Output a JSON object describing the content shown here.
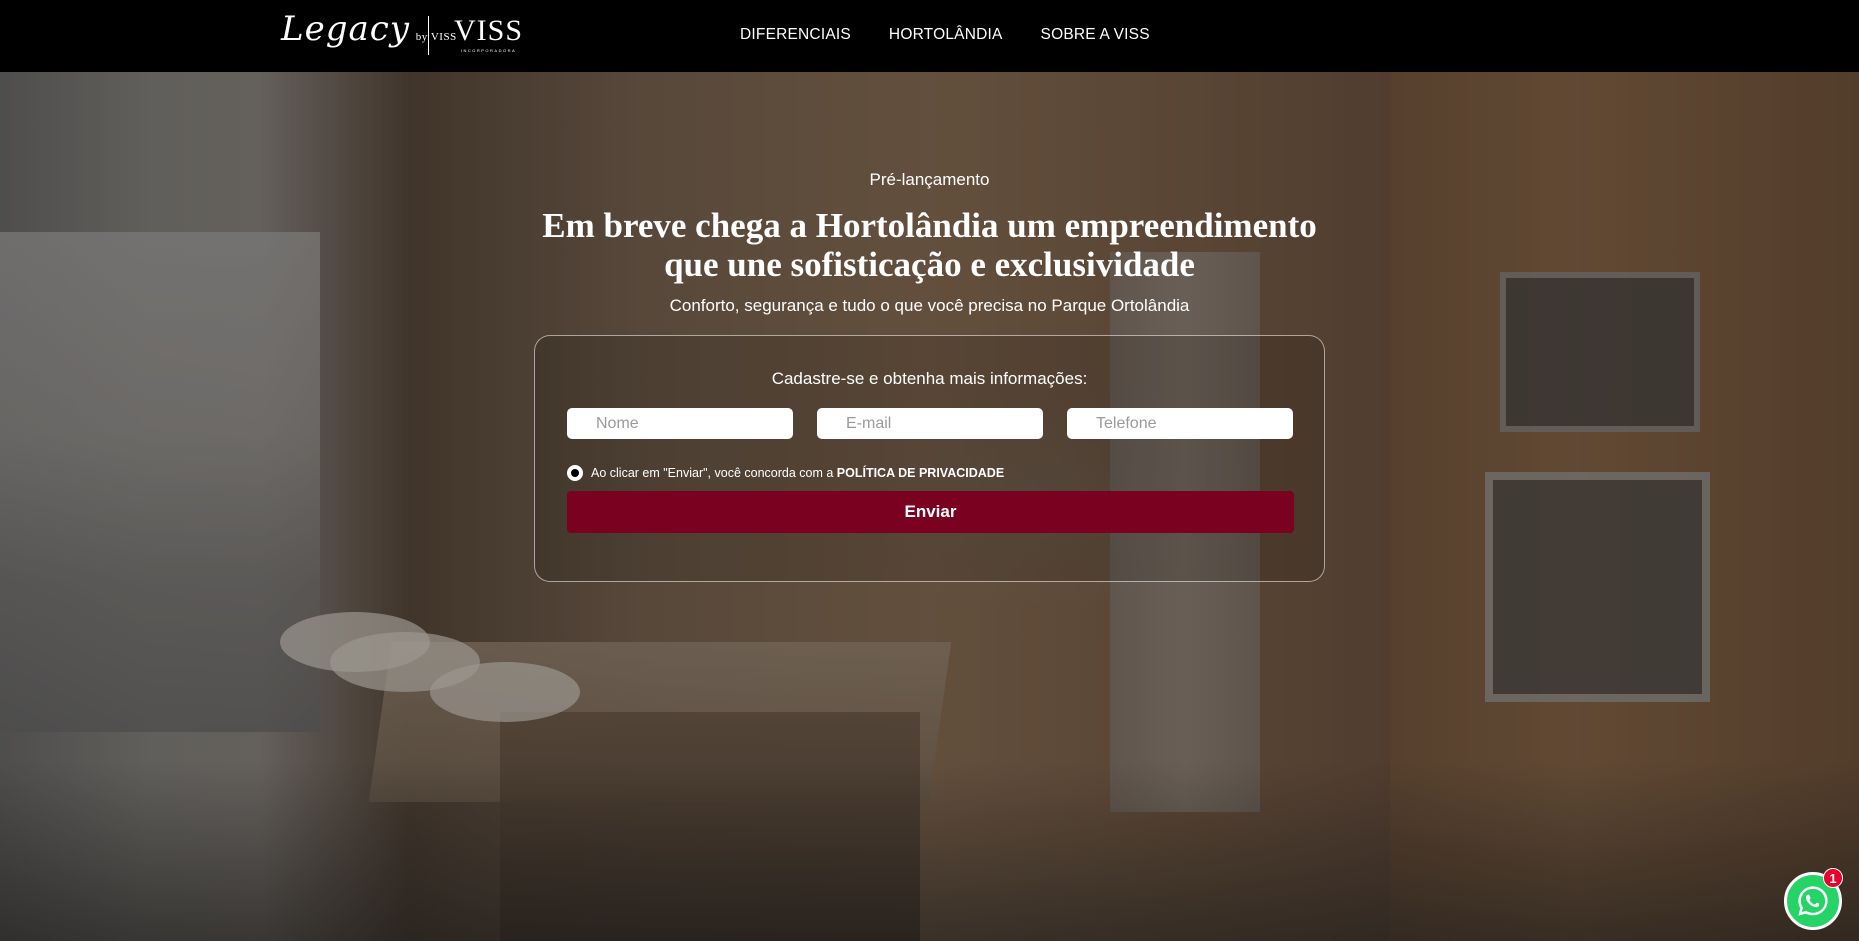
{
  "header": {
    "logo_legacy": "Legacy",
    "logo_legacy_by": "by VISS",
    "logo_viss": "VISS",
    "logo_viss_sub": "INCORPORADORA",
    "nav": [
      {
        "label": "DIFERENCIAIS"
      },
      {
        "label": "HORTOLÂNDIA"
      },
      {
        "label": "SOBRE A VISS"
      }
    ]
  },
  "hero": {
    "eyebrow": "Pré-lançamento",
    "headline_line1": "Em breve chega a Hortolândia um empreendimento",
    "headline_line2": "que une sofisticação e exclusividade",
    "subline": "Conforto, segurança e tudo o que você precisa no Parque Ortolândia"
  },
  "form": {
    "title": "Cadastre-se e obtenha mais informações:",
    "name_placeholder": "Nome",
    "email_placeholder": "E-mail",
    "phone_placeholder": "Telefone",
    "consent_text": "Ao clicar em \"Enviar\", você concorda com a ",
    "consent_link": "POLÍTICA DE PRIVACIDADE",
    "submit_label": "Enviar",
    "submit_color": "#7a0120"
  },
  "whatsapp": {
    "badge_count": "1",
    "icon": "whatsapp-icon",
    "color": "#25d366"
  }
}
